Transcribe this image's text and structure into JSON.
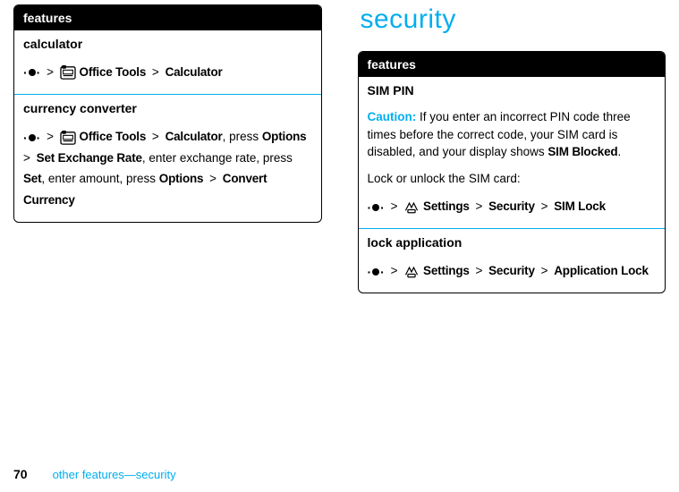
{
  "left": {
    "header": "features",
    "calculator": {
      "title": "calculator",
      "menu_office": "Office Tools",
      "menu_calc": "Calculator"
    },
    "currency": {
      "title": "currency converter",
      "menu_office": "Office Tools",
      "menu_calc": "Calculator",
      "press1": ", press",
      "options": "Options",
      "set_rate": "Set Exchange Rate",
      "enter_rate": ", enter exchange rate, press",
      "set": "Set",
      "enter_amount": ", enter amount, press",
      "options2": "Options",
      "convert": "Convert Currency"
    }
  },
  "right": {
    "section_title": "security",
    "header": "features",
    "sim_pin": {
      "title": "SIM PIN",
      "caution_label": "Caution:",
      "caution_text": " If you enter an incorrect PIN code three times before the correct code, your SIM card is disabled, and your display shows ",
      "sim_blocked": "SIM Blocked",
      "period": ".",
      "lock_text": "Lock or unlock the SIM card:",
      "menu_settings": "Settings",
      "menu_security": "Security",
      "menu_simlock": "SIM Lock"
    },
    "lock_app": {
      "title": "lock application",
      "menu_settings": "Settings",
      "menu_security": "Security",
      "menu_applock": "Application Lock"
    }
  },
  "footer": {
    "page": "70",
    "text": "other features—security"
  },
  "sep": ">"
}
